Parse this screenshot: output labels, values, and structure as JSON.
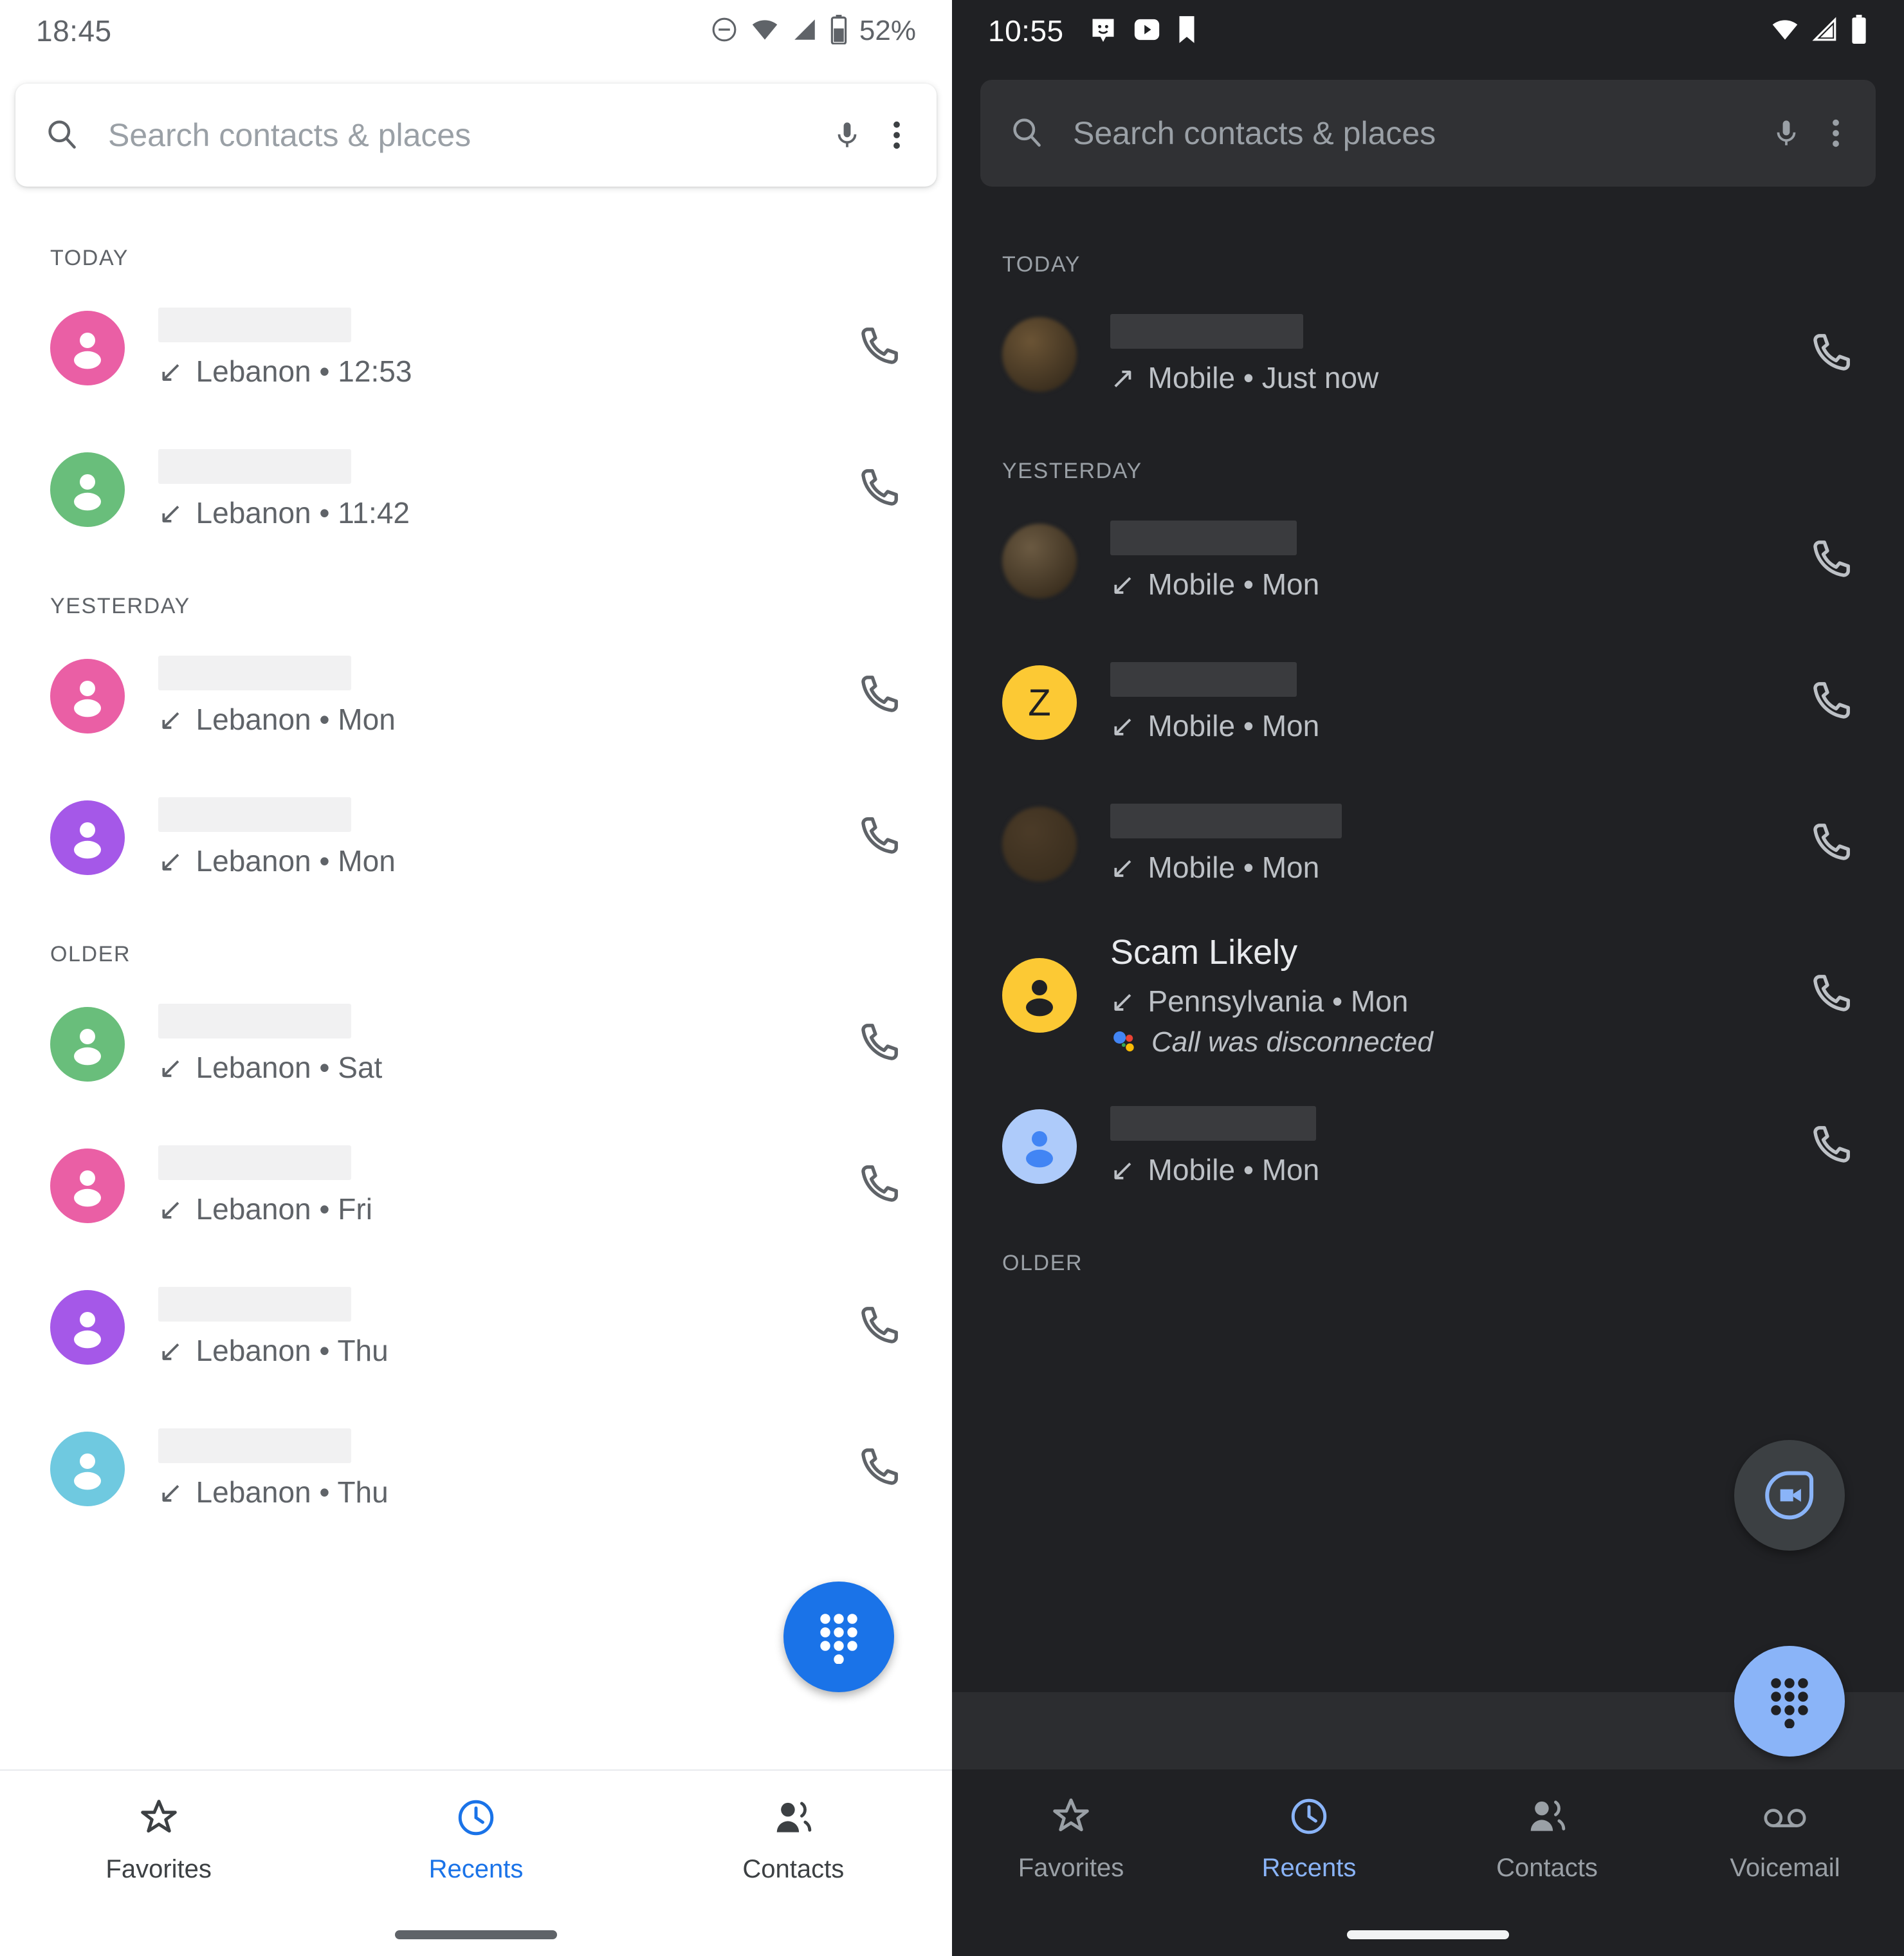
{
  "left_screen": {
    "theme": "light",
    "status_bar": {
      "clock": "18:45",
      "battery_percent": "52%",
      "icons": [
        "dnd-icon",
        "wifi-icon",
        "signal-icon",
        "battery-icon"
      ]
    },
    "search": {
      "placeholder": "Search contacts & places",
      "search_icon": "search-icon",
      "mic_icon": "microphone-icon",
      "overflow_icon": "more-vert-icon"
    },
    "sections": [
      {
        "header": "TODAY",
        "calls": [
          {
            "name": "",
            "redacted": true,
            "redact_width": 300,
            "direction": "incoming",
            "direction_glyph": "↙",
            "detail": "Lebanon • 12:53",
            "avatar_color": "#EA5FA5",
            "avatar_type": "person"
          },
          {
            "name": "",
            "redacted": true,
            "redact_width": 300,
            "direction": "incoming",
            "direction_glyph": "↙",
            "detail": "Lebanon • 11:42",
            "avatar_color": "#69BE7B",
            "avatar_type": "person"
          }
        ]
      },
      {
        "header": "YESTERDAY",
        "calls": [
          {
            "name": "",
            "redacted": true,
            "redact_width": 300,
            "direction": "incoming",
            "direction_glyph": "↙",
            "detail": "Lebanon • Mon",
            "avatar_color": "#EA5FA5",
            "avatar_type": "person"
          },
          {
            "name": "",
            "redacted": true,
            "redact_width": 300,
            "direction": "incoming",
            "direction_glyph": "↙",
            "detail": "Lebanon • Mon",
            "avatar_color": "#A558E8",
            "avatar_type": "person"
          }
        ]
      },
      {
        "header": "OLDER",
        "calls": [
          {
            "name": "",
            "redacted": true,
            "redact_width": 300,
            "direction": "incoming",
            "direction_glyph": "↙",
            "detail": "Lebanon • Sat",
            "avatar_color": "#69BE7B",
            "avatar_type": "person"
          },
          {
            "name": "",
            "redacted": true,
            "redact_width": 300,
            "direction": "incoming",
            "direction_glyph": "↙",
            "detail": "Lebanon • Fri",
            "avatar_color": "#EA5FA5",
            "avatar_type": "person"
          },
          {
            "name": "",
            "redacted": true,
            "redact_width": 300,
            "direction": "incoming",
            "direction_glyph": "↙",
            "detail": "Lebanon • Thu",
            "avatar_color": "#A558E8",
            "avatar_type": "person"
          },
          {
            "name": "",
            "redacted": true,
            "redact_width": 300,
            "direction": "incoming",
            "direction_glyph": "↙",
            "detail": "Lebanon • Thu",
            "avatar_color": "#6FC9E0",
            "avatar_type": "person"
          }
        ]
      }
    ],
    "fab": {
      "name": "dialpad-fab",
      "icon": "dialpad-icon",
      "color": "#1a73e8"
    },
    "bottom_nav": {
      "items": [
        {
          "label": "Favorites",
          "icon": "star-icon",
          "active": false
        },
        {
          "label": "Recents",
          "icon": "clock-icon",
          "active": true
        },
        {
          "label": "Contacts",
          "icon": "people-icon",
          "active": false
        }
      ],
      "active_color": "#1a73e8"
    }
  },
  "right_screen": {
    "theme": "dark",
    "status_bar": {
      "clock": "10:55",
      "battery_percent": "",
      "icons": [
        "chat-notification-icon",
        "youtube-icon",
        "bookmark-icon",
        "wifi-icon",
        "signal-icon",
        "battery-icon"
      ]
    },
    "search": {
      "placeholder": "Search contacts & places",
      "search_icon": "search-icon",
      "mic_icon": "microphone-icon",
      "overflow_icon": "more-vert-icon"
    },
    "sections": [
      {
        "header": "TODAY",
        "calls": [
          {
            "name": "",
            "redacted": true,
            "redact_width": 300,
            "direction": "outgoing",
            "direction_glyph": "↗",
            "detail": "Mobile • Just now",
            "avatar_color": "#6b5435",
            "avatar_type": "photo"
          }
        ]
      },
      {
        "header": "YESTERDAY",
        "calls": [
          {
            "name": "",
            "redacted": true,
            "redact_width": 290,
            "direction": "incoming",
            "direction_glyph": "↙",
            "detail": "Mobile • Mon",
            "avatar_color": "#6b5a42",
            "avatar_type": "photo"
          },
          {
            "name": "",
            "redacted": true,
            "redact_width": 290,
            "direction": "incoming",
            "direction_glyph": "↙",
            "detail": "Mobile • Mon",
            "avatar_color": "#FCC934",
            "avatar_type": "letter",
            "avatar_letter": "Z"
          },
          {
            "name": "",
            "redacted": true,
            "redact_width": 360,
            "direction": "incoming",
            "direction_glyph": "↙",
            "detail": "Mobile • Mon",
            "avatar_color": "#4b3b28",
            "avatar_type": "photo"
          },
          {
            "name": "Scam Likely",
            "redacted": false,
            "direction": "incoming",
            "direction_glyph": "↙",
            "detail": "Pennsylvania • Mon",
            "avatar_color": "#FCC934",
            "avatar_type": "person-dark",
            "assistant_note": "Call was disconnected",
            "assistant_icon": "google-assistant-icon"
          },
          {
            "name": "",
            "redacted": true,
            "redact_width": 320,
            "direction": "incoming",
            "direction_glyph": "↙",
            "detail": "Mobile • Mon",
            "avatar_color": "#AECBFA",
            "avatar_type": "person-blue"
          }
        ]
      },
      {
        "header": "OLDER",
        "calls": []
      }
    ],
    "fabs": [
      {
        "name": "duo-video-call-fab",
        "icon": "duo-video-icon",
        "color": "#3c4043",
        "icon_color": "#8ab4f8"
      },
      {
        "name": "dialpad-fab",
        "icon": "dialpad-icon",
        "color": "#8ab4f8"
      }
    ],
    "bottom_nav": {
      "items": [
        {
          "label": "Favorites",
          "icon": "star-icon",
          "active": false
        },
        {
          "label": "Recents",
          "icon": "clock-icon",
          "active": true
        },
        {
          "label": "Contacts",
          "icon": "people-icon",
          "active": false
        },
        {
          "label": "Voicemail",
          "icon": "voicemail-icon",
          "active": false
        }
      ],
      "active_color": "#8ab4f8"
    }
  }
}
